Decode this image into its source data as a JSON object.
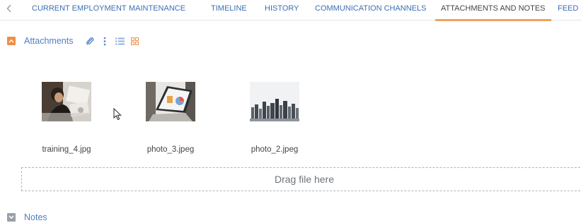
{
  "tabs": {
    "back_icon": "chevron-left-icon",
    "items": [
      {
        "label": "CURRENT EMPLOYMENT"
      },
      {
        "label": "MAINTENANCE"
      },
      {
        "label": "TIMELINE"
      },
      {
        "label": "HISTORY"
      },
      {
        "label": "COMMUNICATION CHANNELS"
      },
      {
        "label": "ATTACHMENTS AND NOTES"
      },
      {
        "label": "FEED"
      }
    ],
    "active": "ATTACHMENTS AND NOTES",
    "accent": "#f0a35b",
    "link_color": "#3c6fb4"
  },
  "attachments": {
    "title": "Attachments",
    "expanded": true,
    "toolbar_icons": [
      "paperclip-icon",
      "kebab-menu-icon",
      "list-view-icon",
      "tile-view-icon"
    ],
    "files": [
      {
        "name": "training_4.jpg"
      },
      {
        "name": "photo_3.jpeg"
      },
      {
        "name": "photo_2.jpeg"
      }
    ],
    "drop_text": "Drag file here"
  },
  "notes": {
    "title": "Notes",
    "expanded": false
  },
  "colors": {
    "section_toggle_open": "#ef8e45",
    "section_toggle_closed": "#9aa0a8",
    "title": "#4f7ec0"
  }
}
